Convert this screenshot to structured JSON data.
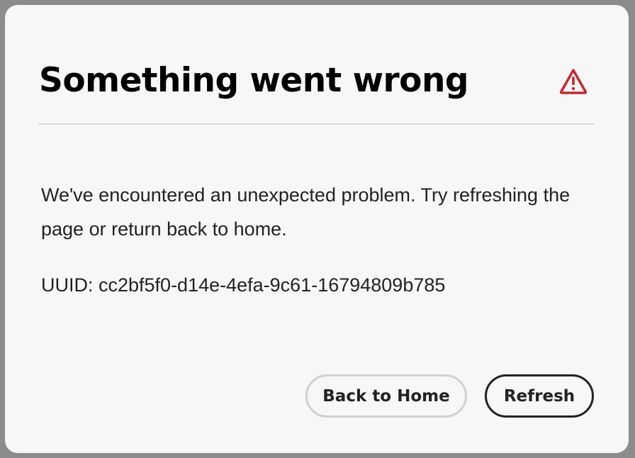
{
  "dialog": {
    "title": "Something went wrong",
    "icon": "alert-triangle-icon",
    "alert_color": "#c9252d",
    "message": "We've encountered an unexpected problem. Try refreshing the page or return back to home.",
    "uuid": "UUID: cc2bf5f0-d14e-4efa-9c61-16794809b785",
    "buttons": {
      "home_label": "Back to Home",
      "refresh_label": "Refresh"
    }
  }
}
